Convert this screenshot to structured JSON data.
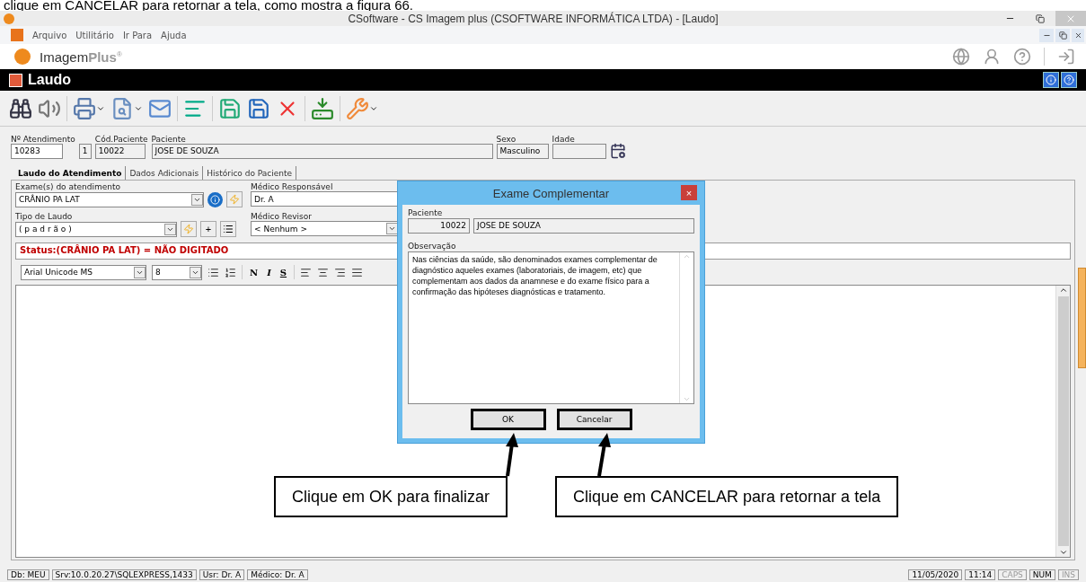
{
  "doc_caption": "clique em CANCELAR para retornar a tela, como mostra a figura 66.",
  "window": {
    "title": "CSoftware - CS Imagem plus (CSOFTWARE INFORMÁTICA LTDA) - [Laudo]"
  },
  "menu": [
    "Arquivo",
    "Utilitário",
    "Ir Para",
    "Ajuda"
  ],
  "brand": {
    "name": "Imagem",
    "suffix": "Plus",
    "mark": "®"
  },
  "form_title": "Laudo",
  "patient_fields": [
    {
      "label": "Nº Atendimento",
      "value": "10283"
    },
    {
      "value": "1"
    },
    {
      "label": "Cód.Paciente",
      "value": "10022"
    },
    {
      "label": "Paciente",
      "value": "JOSE DE SOUZA"
    },
    {
      "label": "Sexo",
      "value": "Masculino"
    },
    {
      "label": "Idade"
    }
  ],
  "tabs": [
    {
      "label": "Laudo do Atendimento",
      "selected": true
    },
    {
      "label": "Dados Adicionais",
      "selected": false
    },
    {
      "label": "Histórico do Paciente",
      "selected": false
    }
  ],
  "exam": {
    "label": "Exame(s) do atendimento",
    "value": "CRÂNIO PA LAT"
  },
  "responsible": {
    "label": "Médico Responsável",
    "value": "Dr. A"
  },
  "report_type": {
    "label": "Tipo de Laudo",
    "value": "( p a d r ã o )",
    "add": "+"
  },
  "reviewer": {
    "label": "Médico Revisor",
    "value": "< Nenhum >"
  },
  "status": "Status:(CRÂNIO PA LAT) = NÃO DIGITADO",
  "editor": {
    "font": "Arial Unicode MS",
    "size": "8",
    "styles": [
      "N",
      "I",
      "S"
    ]
  },
  "dialog": {
    "title": "Exame Complementar",
    "close": "×",
    "patient_label": "Paciente",
    "patient_code": "10022",
    "patient_name": "JOSE DE SOUZA",
    "observation_label": "Observação",
    "observation": "Nas ciências da saúde, são denominados exames complementar de diagnóstico aqueles exames (laboratoriais, de imagem, etc) que complementam aos dados da anamnese e do exame físico para a confirmação das hipóteses diagnósticas e tratamento.",
    "buttons": [
      "OK",
      "Cancelar"
    ]
  },
  "callouts": [
    "Clique em OK para finalizar",
    "Clique em CANCELAR para retornar a tela"
  ],
  "status_bar": {
    "left": [
      "Db: MEU",
      "Srv:10.0.20.27\\SQLEXPRESS,1433",
      "Usr: Dr. A",
      "Médico: Dr. A"
    ],
    "right": [
      {
        "text": "11/05/2020",
        "disabled": false
      },
      {
        "text": "11:14",
        "disabled": false
      },
      {
        "text": "CAPS",
        "disabled": true
      },
      {
        "text": "NUM",
        "disabled": false
      },
      {
        "text": "INS",
        "disabled": true
      }
    ]
  }
}
